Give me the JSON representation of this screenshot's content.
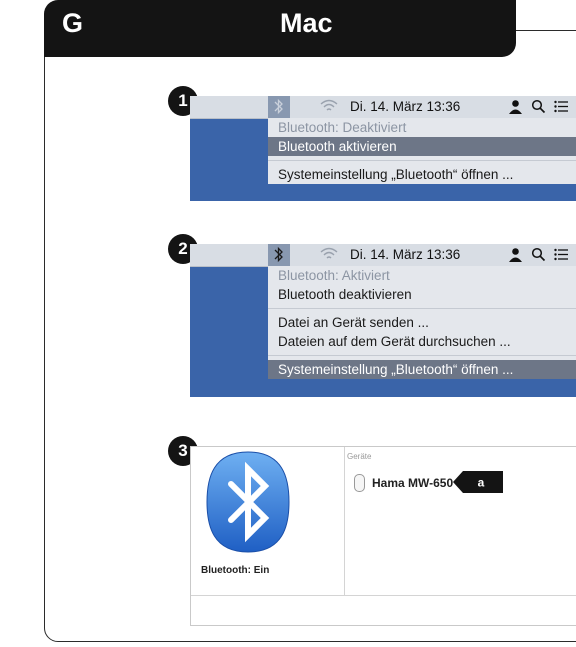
{
  "header": {
    "section": "G",
    "title": "Mac"
  },
  "steps": [
    "1",
    "2",
    "3"
  ],
  "panel1": {
    "menubar": {
      "bluetooth_icon": "bluetooth-icon",
      "wifi_icon": "wifi-icon",
      "datetime": "Di. 14. März 13:36"
    },
    "menu": [
      "Bluetooth: Deaktiviert",
      "Bluetooth aktivieren",
      "Systemeinstellung „Bluetooth“ öffnen ..."
    ]
  },
  "panel2": {
    "menubar": {
      "datetime": "Di. 14. März 13:36"
    },
    "menu": [
      "Bluetooth: Aktiviert",
      "Bluetooth deaktivieren",
      "Datei an Gerät senden ...",
      "Dateien auf dem Gerät durchsuchen ...",
      "Systemeinstellung „Bluetooth“ öffnen ..."
    ]
  },
  "panel3": {
    "status": "Bluetooth: Ein",
    "devices_heading": "Geräte",
    "device_name": "Hama MW-650",
    "callout": "a"
  },
  "colors": {
    "dark": "#141414",
    "desktop_blue": "#3a64a9",
    "highlight": "#6d7687",
    "bt_blue": "#2f6fd6"
  }
}
